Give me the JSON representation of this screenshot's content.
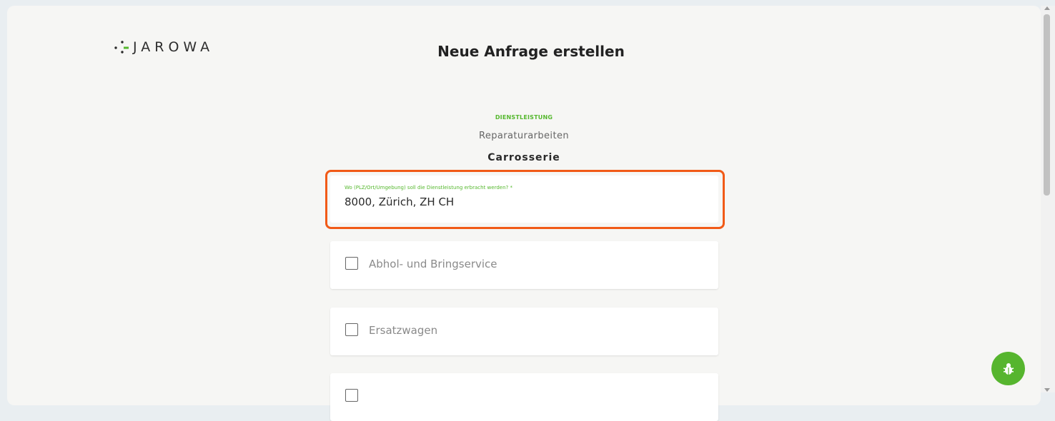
{
  "header": {
    "logo_text": "JAROWA",
    "title": "Neue Anfrage erstellen"
  },
  "request": {
    "section_label": "DIENSTLEISTUNG",
    "category": "Reparaturarbeiten",
    "service": "Carrosserie"
  },
  "location_field": {
    "label": "Wo (PLZ/Ort/Umgebung) soll die Dienstleistung erbracht werden? *",
    "value": "8000, Zürich, ZH CH"
  },
  "options": [
    {
      "label": "Abhol- und Bringservice",
      "checked": false
    },
    {
      "label": "Ersatzwagen",
      "checked": false
    },
    {
      "label": "",
      "checked": false
    }
  ],
  "colors": {
    "accent_green": "#55b82e",
    "highlight_orange": "#f15a17"
  },
  "icons": {
    "report_bug": "bug-icon"
  }
}
